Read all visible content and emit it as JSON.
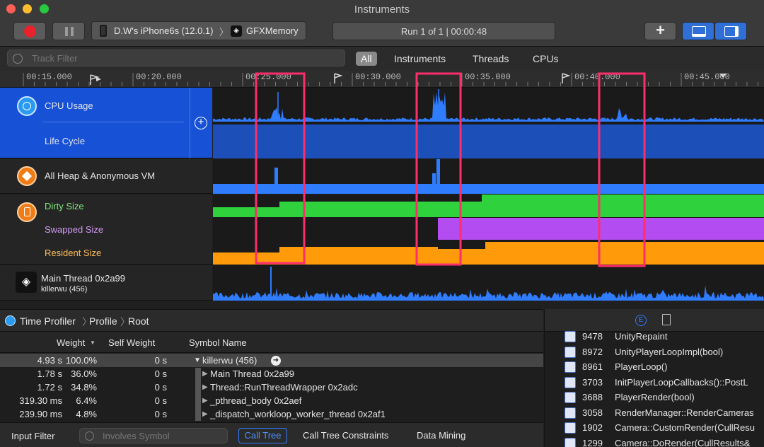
{
  "window": {
    "title": "Instruments"
  },
  "toolbar": {
    "device": "D.W's iPhone6s (12.0.1)",
    "separator": "〉",
    "target": "GFXMemory",
    "run": "Run 1 of 1  |  00:00:48",
    "add_label": "+"
  },
  "filter": {
    "placeholder": "Track Filter",
    "scopes": [
      "All",
      "Instruments",
      "Threads",
      "CPUs"
    ]
  },
  "ruler": {
    "ticks": [
      "00:15.000",
      "00:20.000",
      "00:25.000",
      "00:30.000",
      "00:35.000",
      "00:40.000",
      "00:45.000"
    ]
  },
  "tracks": {
    "cpu": {
      "label": "CPU Usage",
      "sub": "Life Cycle"
    },
    "heap": {
      "label": "All Heap & Anonymous VM"
    },
    "vm": {
      "dirty": "Dirty Size",
      "swapped": "Swapped Size",
      "resident": "Resident Size"
    },
    "thread": {
      "label": "Main Thread  0x2a99",
      "sub": "killerwu (456)"
    }
  },
  "colors": {
    "cpu_selected": "#1651d6",
    "graph_blue": "#2f7cff",
    "dirty": "#2fd13c",
    "swapped": "#b34df2",
    "resident": "#ff9a0a",
    "highlight": "#ff2d6c"
  },
  "detail": {
    "breadcrumb": [
      "Time Profiler",
      "Profile",
      "Root"
    ],
    "columns": {
      "weight": "Weight",
      "self": "Self Weight",
      "symbol": "Symbol Name"
    },
    "rows": [
      {
        "weight": "4.93 s",
        "pct": "100.0%",
        "self": "0 s",
        "symbol": "killerwu (456)",
        "expand": "▼"
      },
      {
        "weight": "1.78 s",
        "pct": "36.0%",
        "self": "0 s",
        "symbol": "Main Thread  0x2a99",
        "expand": "▶"
      },
      {
        "weight": "1.72 s",
        "pct": "34.8%",
        "self": "0 s",
        "symbol": "Thread::RunThreadWrapper  0x2adc",
        "expand": "▶"
      },
      {
        "weight": "319.30 ms",
        "pct": "6.4%",
        "self": "0 s",
        "symbol": "_pthread_body  0x2aef",
        "expand": "▶"
      },
      {
        "weight": "239.90 ms",
        "pct": "4.8%",
        "self": "0 s",
        "symbol": "_dispatch_workloop_worker_thread  0x2af1",
        "expand": "▶"
      }
    ]
  },
  "bottom": {
    "input_filter": "Input Filter",
    "involves_placeholder": "Involves Symbol",
    "call_tree": "Call Tree",
    "constraints": "Call Tree Constraints",
    "data_mining": "Data Mining"
  },
  "stack": [
    {
      "count": "9478",
      "symbol": "UnityRepaint"
    },
    {
      "count": "8972",
      "symbol": "UnityPlayerLoopImpl(bool)"
    },
    {
      "count": "8961",
      "symbol": "PlayerLoop()"
    },
    {
      "count": "3703",
      "symbol": "InitPlayerLoopCallbacks()::PostL"
    },
    {
      "count": "3688",
      "symbol": "PlayerRender(bool)"
    },
    {
      "count": "3058",
      "symbol": "RenderManager::RenderCameras"
    },
    {
      "count": "1902",
      "symbol": "Camera::CustomRender(CullResu"
    },
    {
      "count": "1299",
      "symbol": "Camera::DoRender(CullResults&"
    }
  ]
}
